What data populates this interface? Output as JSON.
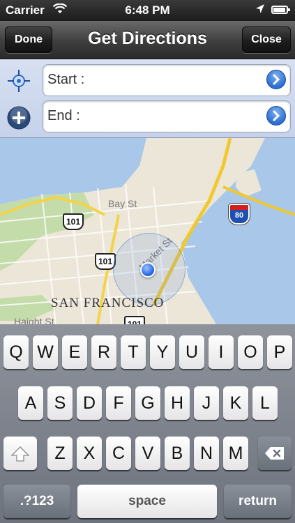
{
  "status_bar": {
    "carrier": "Carrier",
    "wifi_icon": "wifi-icon",
    "time": "6:48 PM",
    "location_icon": "location-arrow-icon",
    "battery_icon": "battery-icon"
  },
  "nav": {
    "title": "Get Directions",
    "done_label": "Done",
    "close_label": "Close"
  },
  "inputs": {
    "start_label": "Start :",
    "start_icon": "current-location-crosshair-icon",
    "end_label": "End :",
    "end_icon": "add-circle-icon",
    "go_icon": "chevron-right-circle-icon"
  },
  "map": {
    "city_label": "SAN FRANCISCO",
    "streets": [
      "Bay St",
      "Market St",
      "Haight St"
    ],
    "highways": [
      "101",
      "101",
      "101"
    ],
    "interstate": "80"
  },
  "keyboard": {
    "row1": [
      "Q",
      "W",
      "E",
      "R",
      "T",
      "Y",
      "U",
      "I",
      "O",
      "P"
    ],
    "row2": [
      "A",
      "S",
      "D",
      "F",
      "G",
      "H",
      "J",
      "K",
      "L"
    ],
    "row3": [
      "Z",
      "X",
      "C",
      "V",
      "B",
      "N",
      "M"
    ],
    "shift_icon": "shift-arrow-icon",
    "delete_icon": "backspace-icon",
    "numbers_label": ".?123",
    "space_label": "space",
    "return_label": "return"
  },
  "colors": {
    "nav_bar": "#3e3e3e",
    "input_panel": "#c5d2ea",
    "go_button": "#2c6ed0",
    "keyboard_bg": "#7e838c"
  }
}
